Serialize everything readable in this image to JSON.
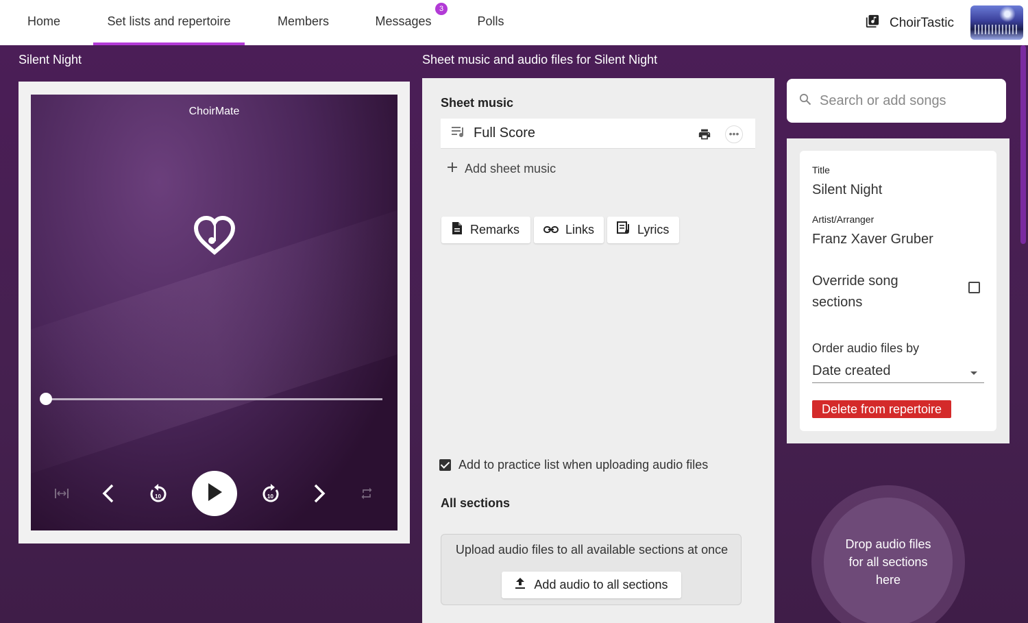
{
  "nav": {
    "tabs": [
      {
        "label": "Home"
      },
      {
        "label": "Set lists and repertoire"
      },
      {
        "label": "Members"
      },
      {
        "label": "Messages"
      },
      {
        "label": "Polls"
      }
    ],
    "messages_badge": "3",
    "active_tab": "Set lists and repertoire",
    "brand": "ChoirTastic",
    "accent_color": "#b23ad6"
  },
  "left": {
    "song_title": "Silent Night",
    "player": {
      "label": "ChoirMate",
      "progress": 0.0,
      "controls": [
        "fit-width-icon",
        "previous-icon",
        "rewind-10-icon",
        "play-icon",
        "forward-10-icon",
        "next-icon",
        "repeat-icon"
      ]
    }
  },
  "middle": {
    "heading": "Sheet music and audio files for Silent Night",
    "sheet_music_heading": "Sheet music",
    "sheet_items": [
      {
        "title": "Full Score"
      }
    ],
    "add_sheet_label": "Add sheet music",
    "chips": {
      "remarks": "Remarks",
      "links": "Links",
      "lyrics": "Lyrics"
    },
    "practice_checkbox_label": "Add to practice list when uploading audio files",
    "practice_checked": true,
    "sections_heading": "All sections",
    "upload_text": "Upload audio files to all available sections at once",
    "upload_button": "Add audio to all sections"
  },
  "right": {
    "search_placeholder": "Search or add songs",
    "title_label": "Title",
    "title_value": "Silent Night",
    "artist_label": "Artist/Arranger",
    "artist_value": "Franz Xaver Gruber",
    "override_label": "Override song sections",
    "override_checked": false,
    "order_label": "Order audio files by",
    "order_value": "Date created",
    "delete_label": "Delete from repertoire",
    "delete_color": "#d42a2a",
    "drop_text": "Drop audio files for all sections here"
  }
}
